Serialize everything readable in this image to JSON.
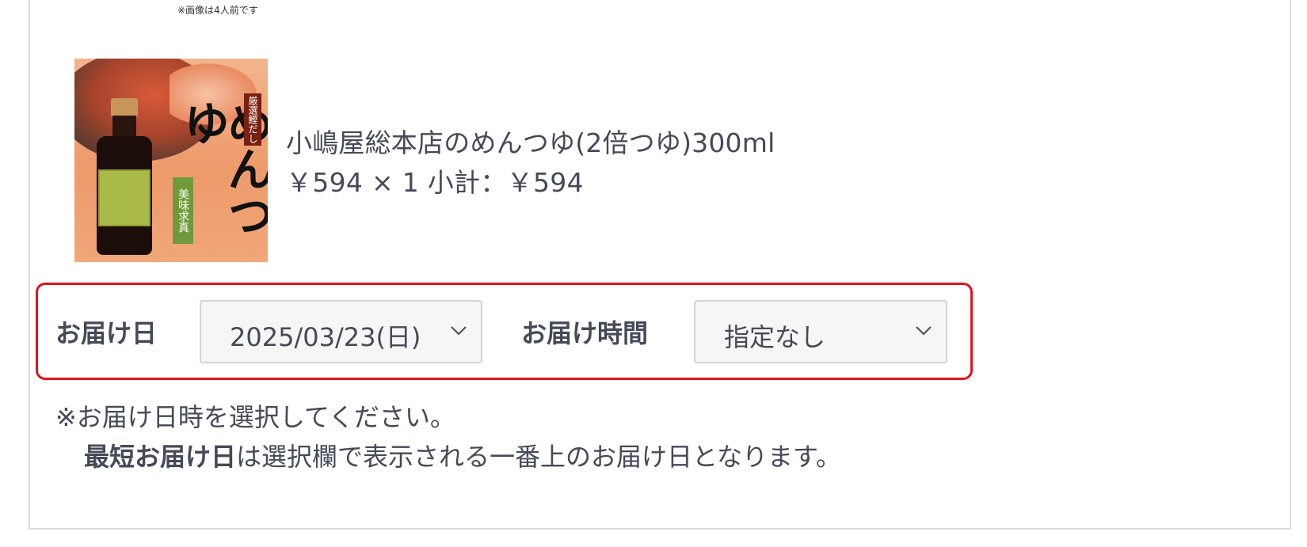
{
  "image_caption": "※画像は4人前です",
  "product": {
    "image_alt": "小嶋屋総本店のめんつゆ",
    "image_texts": {
      "big": "めんつゆ",
      "label": "めんつゆ",
      "tag_top": "厳選鰹だし",
      "tag_side": "美味求真"
    },
    "name": "小嶋屋総本店のめんつゆ(2倍つゆ)300ml",
    "price_line": "￥594 × 1  小計：￥594"
  },
  "delivery": {
    "date_label": "お届け日",
    "date_value": "2025/03/23(日)",
    "time_label": "お届け時間",
    "time_value": "指定なし",
    "highlight_color": "#e0141c"
  },
  "notes": {
    "line1": "※お届け日時を選択してください。",
    "line2_bold": "最短お届け日",
    "line2_rest": "は選択欄で表示される一番上のお届け日となります。"
  }
}
